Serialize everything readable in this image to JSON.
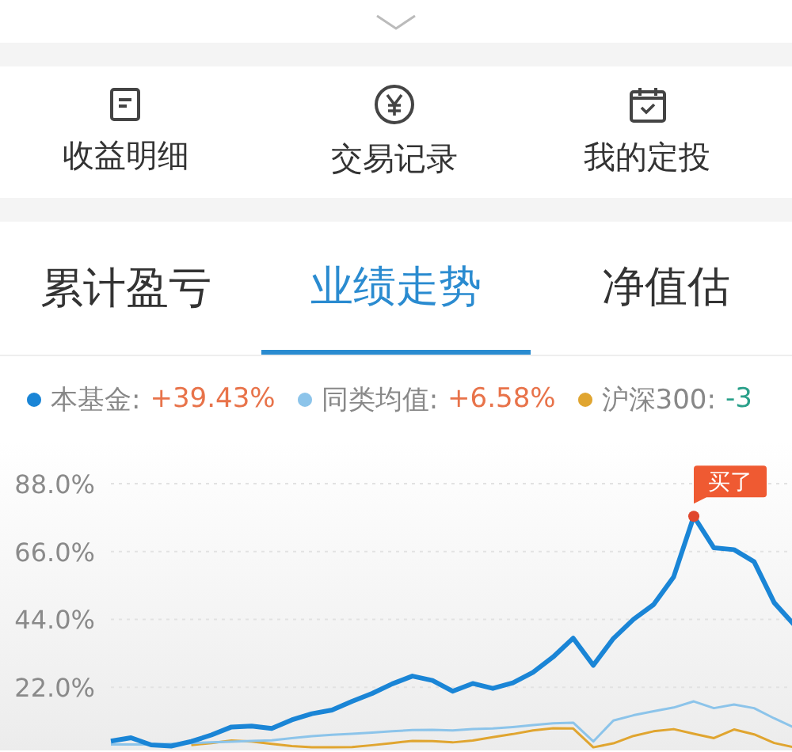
{
  "shortcuts": [
    {
      "label": "收益明细"
    },
    {
      "label": "交易记录"
    },
    {
      "label": "我的定投"
    }
  ],
  "tabs": [
    {
      "label": "累计盈亏",
      "selected": false
    },
    {
      "label": "业绩走势",
      "selected": true
    },
    {
      "label": "净值估",
      "selected": false
    }
  ],
  "legend": [
    {
      "label": "本基金:",
      "value": "+39.43%",
      "color": "#1a85d6",
      "kind": "gain"
    },
    {
      "label": "同类均值:",
      "value": "+6.58%",
      "color": "#8cc4ea",
      "kind": "gain"
    },
    {
      "label": "沪深300:",
      "value": "-3",
      "color": "#e0a530",
      "kind": "loss"
    }
  ],
  "chart": {
    "chart_data": {
      "type": "line",
      "categories": [
        null,
        null,
        null,
        null,
        null,
        null,
        null,
        null,
        null,
        null,
        null,
        null,
        null,
        null,
        null,
        null,
        null,
        null,
        null,
        null,
        null,
        null,
        null,
        null,
        null,
        null,
        null,
        null,
        null,
        null,
        null,
        null,
        null,
        null,
        null
      ],
      "ylim": [
        1.5,
        101.6
      ],
      "yticks": [
        {
          "value": 22,
          "label": "22.0%"
        },
        {
          "value": 44,
          "label": "44.0%"
        },
        {
          "value": 66,
          "label": "66.0%"
        },
        {
          "value": 88,
          "label": "88.0%"
        }
      ],
      "series": [
        {
          "color": "#1a85d6",
          "values": [
            4.5,
            5.6,
            3.3,
            2.9,
            4.4,
            6.5,
            9.1,
            9.4,
            8.6,
            11.4,
            13.4,
            14.6,
            17.4,
            20,
            23.1,
            25.6,
            24.2,
            20.7,
            23.2,
            21.6,
            23.4,
            26.8,
            31.8,
            37.9,
            29.1,
            37.8,
            44,
            48.8,
            57.8,
            77.4,
            67.2,
            66.6,
            62.7,
            49.4,
            42.2
          ]
        },
        {
          "color": "#8cc4ea",
          "values": [
            3.4,
            3.4,
            3.4,
            3.6,
            3.9,
            4.1,
            4.3,
            4.6,
            4.8,
            5.5,
            6.1,
            6.6,
            6.9,
            7.3,
            7.7,
            8.1,
            8.2,
            8.0,
            8.4,
            8.6,
            9.1,
            9.7,
            10.3,
            10.5,
            4.4,
            11.2,
            12.9,
            14.2,
            15.4,
            17.4,
            15.2,
            16.4,
            15.2,
            11.9,
            8.9
          ]
        },
        {
          "color": "#e0a530",
          "values": [
            null,
            null,
            null,
            null,
            3.2,
            3.9,
            4.7,
            4.4,
            3.6,
            2.9,
            2.5,
            2.5,
            2.6,
            3.2,
            3.9,
            4.6,
            4.5,
            4.1,
            4.7,
            5.8,
            6.8,
            8.0,
            8.7,
            8.6,
            2.5,
            3.8,
            6.2,
            7.7,
            8.4,
            6.9,
            5.5,
            8.3,
            6.7,
            3.9,
            2.5
          ]
        }
      ],
      "grid": true,
      "annotations": [
        "买了"
      ]
    }
  }
}
